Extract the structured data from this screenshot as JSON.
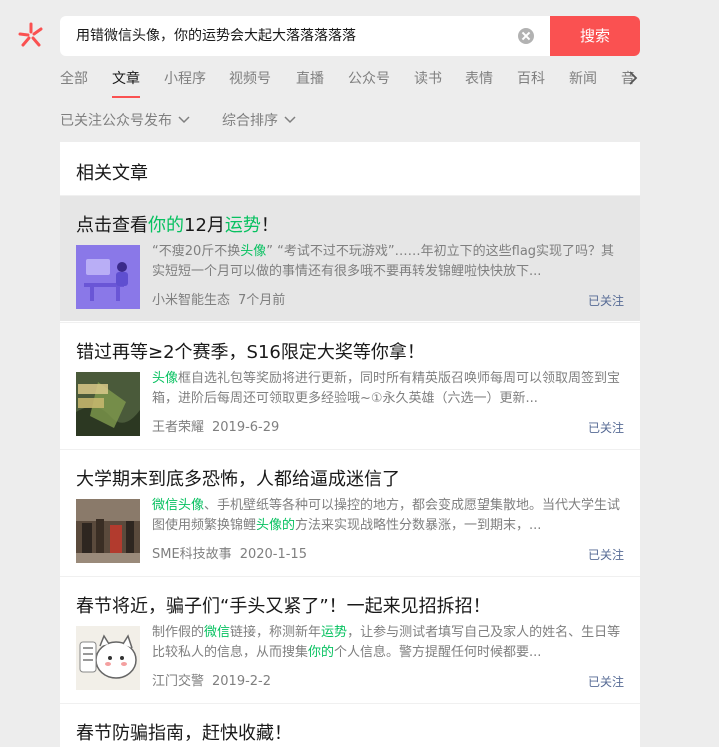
{
  "colors": {
    "accent": "#fa5151",
    "highlight": "#07c160",
    "link": "#576b95"
  },
  "search": {
    "query": "用错微信头像，你的运势会大起大落落落落落",
    "button_label": "搜索"
  },
  "tabs": [
    "全部",
    "文章",
    "小程序",
    "视频号",
    "直播",
    "公众号",
    "读书",
    "表情",
    "百科",
    "新闻",
    "音"
  ],
  "active_tab": "文章",
  "filters": {
    "publish": "已关注公众号发布",
    "sort": "综合排序"
  },
  "section_title": "相关文章",
  "results": [
    {
      "title": [
        "点击查看",
        "你的",
        "12月",
        "运势",
        "！"
      ],
      "desc": [
        "“不瘦20斤不换",
        "头像",
        "” “考试不过不玩游戏”……年初立下的这些flag实现了吗？其实短短一个月可以做的事情还有很多哦不要再转发锦鲤啦快快放下..."
      ],
      "source": "小米智能生态",
      "time": "7个月前",
      "followed": "已关注"
    },
    {
      "title": [
        "错过再等≥2个赛季，S16限定大奖等你拿！"
      ],
      "desc": [
        "",
        "头像",
        "框自选礼包等奖励将进行更新，同时所有精英版召唤师每周可以领取周签到宝箱，进阶后每周还可领取更多经验哦~①永久英雄（六选一）更新..."
      ],
      "source": "王者荣耀",
      "time": "2019-6-29",
      "followed": "已关注"
    },
    {
      "title": [
        "大学期末到底多恐怖，人都给逼成迷信了"
      ],
      "desc": [
        "",
        "微信头像",
        "、手机壁纸等各种可以操控的地方，都会变成愿望集散地。当代大学生试图使用频繁换锦鲤",
        "头像",
        "的",
        "方法来实现战略性分数暴涨，一到期末，..."
      ],
      "source": "SME科技故事",
      "time": "2020-1-15",
      "followed": "已关注"
    },
    {
      "title": [
        "春节将近，骗子们“手头又紧了”！一起来见招拆招！"
      ],
      "desc": [
        "制作假的",
        "微信",
        "链接，称测新年",
        "运势",
        "，让参与测试者填写自己及家人的姓名、生日等比较私人的信息，从而搜集",
        "你的",
        "个人信息。警方提醒任何时候都要..."
      ],
      "source": "江门交警",
      "time": "2019-2-2",
      "followed": "已关注"
    },
    {
      "title": [
        "春节防骗指南，赶快收藏！"
      ]
    }
  ],
  "icons": {
    "logo": "wechat-search-logo-icon",
    "clear": "clear-icon",
    "more_tabs": "chevron-right-icon",
    "dropdown": "chevron-down-icon"
  }
}
